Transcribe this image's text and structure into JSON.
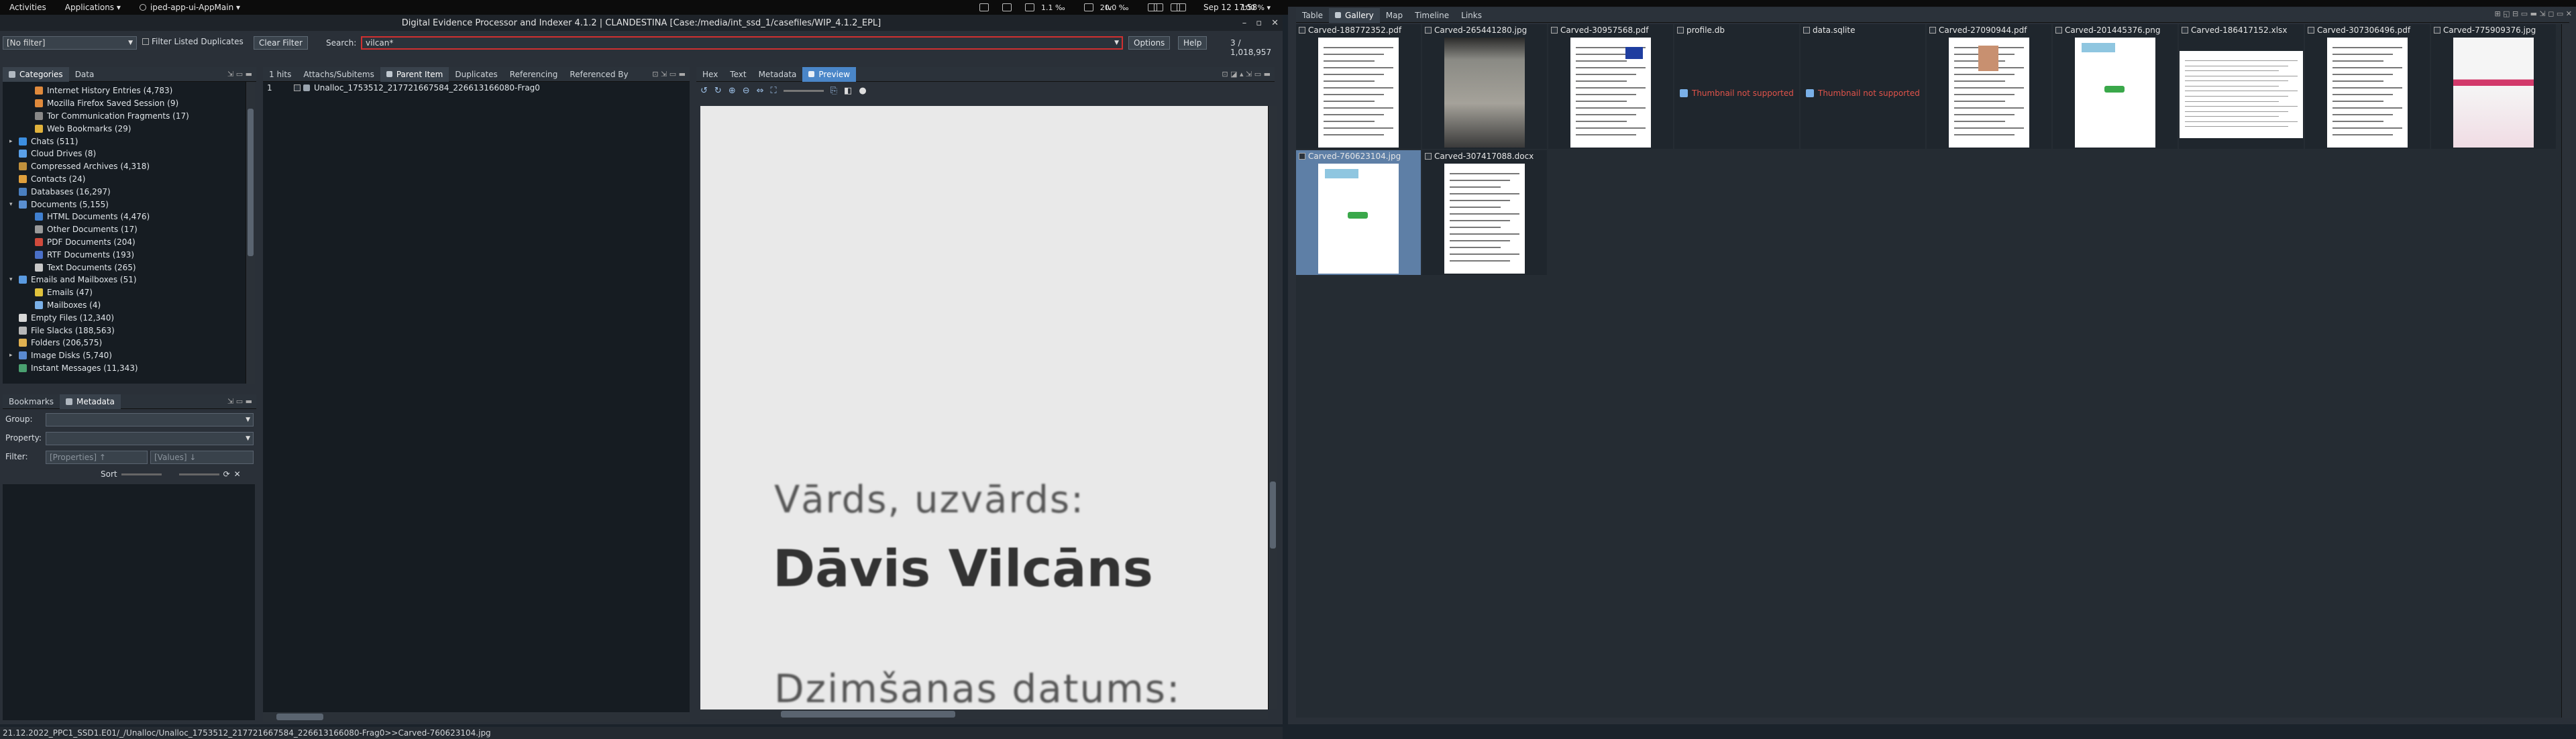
{
  "topbar": {
    "activities": "Activities",
    "applications": "Applications",
    "app_name": "iped-app-ui-AppMain",
    "datetime": "Sep 12  17:58",
    "indicators": [
      "1.1 ‰",
      "20.0 ‰",
      "lv",
      "100 %"
    ]
  },
  "window": {
    "title": "Digital Evidence Processor and Indexer 4.1.2 | CLANDESTINA   [Case:/media/int_ssd_1/casefiles/WIP_4.1.2_EPL]"
  },
  "filterbar": {
    "filter_select": "[No filter]",
    "filter_dup_label": "Filter Listed Duplicates",
    "clear_filter": "Clear Filter",
    "search_label": "Search:",
    "search_value": "vilcan*",
    "options": "Options",
    "help": "Help",
    "hits_count": "3 / 1,018,957"
  },
  "left_tabs": [
    "Categories",
    "Data"
  ],
  "categories": [
    {
      "label": "Internet History Entries (4,783)",
      "level": 2,
      "color": "#e08a3c"
    },
    {
      "label": "Mozilla Firefox Saved Session (9)",
      "level": 2,
      "color": "#e08a3c"
    },
    {
      "label": "Tor Communication Fragments (17)",
      "level": 2,
      "color": "#888888"
    },
    {
      "label": "Web Bookmarks (29)",
      "level": 2,
      "color": "#e0b23c"
    },
    {
      "label": "Chats (511)",
      "level": 1,
      "color": "#3c8ee0",
      "arrow": "▸"
    },
    {
      "label": "Cloud Drives (8)",
      "level": 1,
      "color": "#5aa0e8"
    },
    {
      "label": "Compressed Archives (4,318)",
      "level": 1,
      "color": "#c0903c"
    },
    {
      "label": "Contacts (24)",
      "level": 1,
      "color": "#e0a03c"
    },
    {
      "label": "Databases (16,297)",
      "level": 1,
      "color": "#4a7fc0"
    },
    {
      "label": "Documents (5,155)",
      "level": 1,
      "color": "#5a8fd0",
      "arrow": "▾"
    },
    {
      "label": "HTML Documents (4,476)",
      "level": 2,
      "color": "#4080d0"
    },
    {
      "label": "Other Documents (17)",
      "level": 2,
      "color": "#9a9a9a"
    },
    {
      "label": "PDF Documents (204)",
      "level": 2,
      "color": "#d04a3c"
    },
    {
      "label": "RTF Documents (193)",
      "level": 2,
      "color": "#4a70c8"
    },
    {
      "label": "Text Documents (265)",
      "level": 2,
      "color": "#c8c8c8"
    },
    {
      "label": "Emails and Mailboxes (51)",
      "level": 1,
      "color": "#5a9ae0",
      "arrow": "▾"
    },
    {
      "label": "Emails (47)",
      "level": 2,
      "color": "#e0c23c"
    },
    {
      "label": "Mailboxes (4)",
      "level": 2,
      "color": "#7ab0e8"
    },
    {
      "label": "Empty Files (12,340)",
      "level": 1,
      "color": "#d8d8d8"
    },
    {
      "label": "File Slacks (188,563)",
      "level": 1,
      "color": "#b8b8b8"
    },
    {
      "label": "Folders (206,575)",
      "level": 1,
      "color": "#e0b050"
    },
    {
      "label": "Image Disks (5,740)",
      "level": 1,
      "color": "#5a8ad0",
      "arrow": "▸"
    },
    {
      "label": "Instant Messages (11,343)",
      "level": 1,
      "color": "#4aa070"
    }
  ],
  "bottom_left": {
    "tabs": [
      "Bookmarks",
      "Metadata"
    ],
    "group_label": "Group:",
    "property_label": "Property:",
    "filter_label": "Filter:",
    "filter_props_placeholder": "[Properties] ↑",
    "filter_values_placeholder": "[Values] ↓",
    "sort_label": "Sort"
  },
  "results_tabs": [
    "1 hits",
    "Attachs/Subitems",
    "Parent Item",
    "Duplicates",
    "Referencing",
    "Referenced By"
  ],
  "results": [
    {
      "num": "1",
      "name": "Unalloc_1753512_217721667584_226613166080-Frag0"
    }
  ],
  "viewer_tabs": [
    "Hex",
    "Text",
    "Metadata",
    "Preview"
  ],
  "preview": {
    "line1": "Vārds, uzvārds:",
    "line2": "Dāvis Vilcāns",
    "line3": "Dzimšanas datums:"
  },
  "status_path": "21.12.2022_PPC1_SSD1.E01/_/Unalloc/Unalloc_1753512_217721667584_226613166080-Frag0>>Carved-760623104.jpg",
  "right_tabs": [
    "Table",
    "Gallery",
    "Map",
    "Timeline",
    "Links"
  ],
  "gallery": [
    {
      "name": "Carved-188772352.pdf",
      "kind": "doc"
    },
    {
      "name": "Carved-265441280.jpg",
      "kind": "photo"
    },
    {
      "name": "Carved-30957568.pdf",
      "kind": "cert"
    },
    {
      "name": "profile.db",
      "kind": "none"
    },
    {
      "name": "data.sqlite",
      "kind": "none"
    },
    {
      "name": "Carved-27090944.pdf",
      "kind": "id"
    },
    {
      "name": "Carved-201445376.png",
      "kind": "greenpage"
    },
    {
      "name": "Carved-186417152.xlsx",
      "kind": "sheet"
    },
    {
      "name": "Carved-307306496.pdf",
      "kind": "doc2"
    },
    {
      "name": "Carved-775909376.jpg",
      "kind": "pink"
    },
    {
      "name": "Carved-760623104.jpg",
      "kind": "greenpage",
      "selected": true
    },
    {
      "name": "Carved-307417088.docx",
      "kind": "doc"
    }
  ],
  "not_supported": "Thumbnail not supported"
}
